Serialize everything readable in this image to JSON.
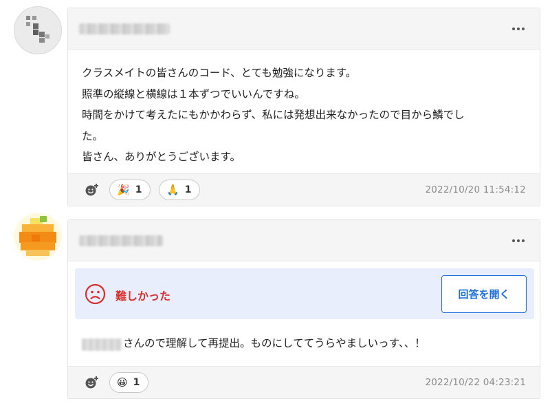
{
  "posts": [
    {
      "avatar": "gray-pixel-avatar",
      "body_lines": [
        "クラスメイトの皆さんのコード、とても勉強になります。",
        "照準の縦線と横線は１本ずつでいいんですね。",
        "時間をかけて考えたにもかかわらず、私には発想出来なかったので目から鱗でし",
        "た。",
        "皆さん、ありがとうございます。"
      ],
      "reactions": [
        {
          "emoji": "🎉",
          "icon": "party-popper-icon",
          "count": "1"
        },
        {
          "emoji": "🙏",
          "icon": "folded-hands-icon",
          "count": "1"
        }
      ],
      "timestamp": "2022/10/20 11:54:12"
    },
    {
      "avatar": "orange-pixel-avatar",
      "status": {
        "icon": "sad-face-icon",
        "label": "難しかった",
        "color": "#d9302e"
      },
      "answer_button": "回答を開く",
      "body": "さんので理解して再提出。ものにしててうらやましいっす、、！",
      "reactions": [
        {
          "emoji": "😀",
          "icon": "grinning-face-icon",
          "count": "1"
        }
      ],
      "timestamp": "2022/10/22 04:23:21"
    }
  ],
  "colors": {
    "accent": "#1e6fd9",
    "status_red": "#d9302e",
    "status_bg": "#e8eefc"
  }
}
